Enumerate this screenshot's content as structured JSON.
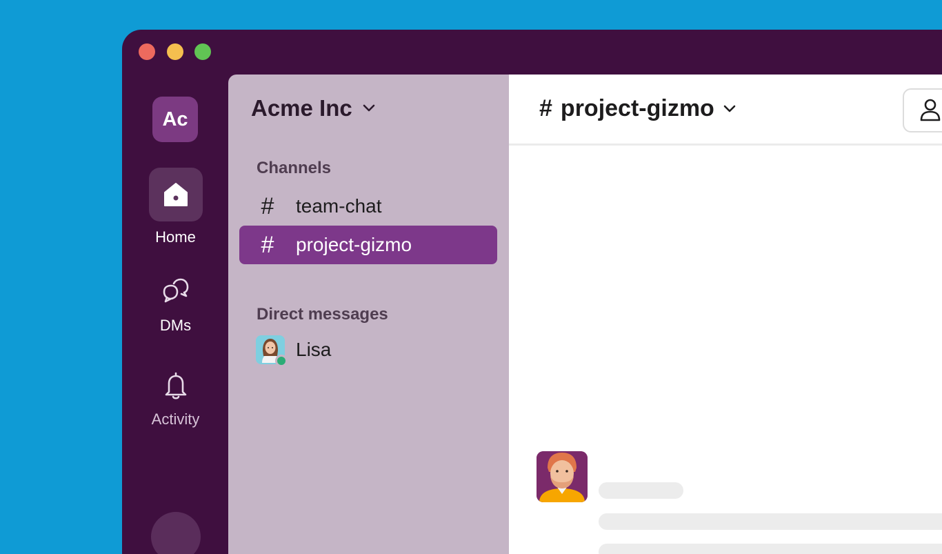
{
  "workspace": {
    "initials": "Ac",
    "name": "Acme Inc"
  },
  "rail": {
    "home_label": "Home",
    "dms_label": "DMs",
    "activity_label": "Activity"
  },
  "sidebar": {
    "channels_heading": "Channels",
    "channels": [
      {
        "name": "team-chat",
        "active": false
      },
      {
        "name": "project-gizmo",
        "active": true
      }
    ],
    "dms_heading": "Direct messages",
    "dms": [
      {
        "name": "Lisa",
        "status": "online"
      }
    ]
  },
  "channel": {
    "hash": "#",
    "name": "project-gizmo"
  },
  "colors": {
    "background": "#0f9bd5",
    "window": "#3f0f3f",
    "sidebar": "#c5b5c6",
    "active_channel": "#7d388a",
    "presence": "#2bac76"
  }
}
